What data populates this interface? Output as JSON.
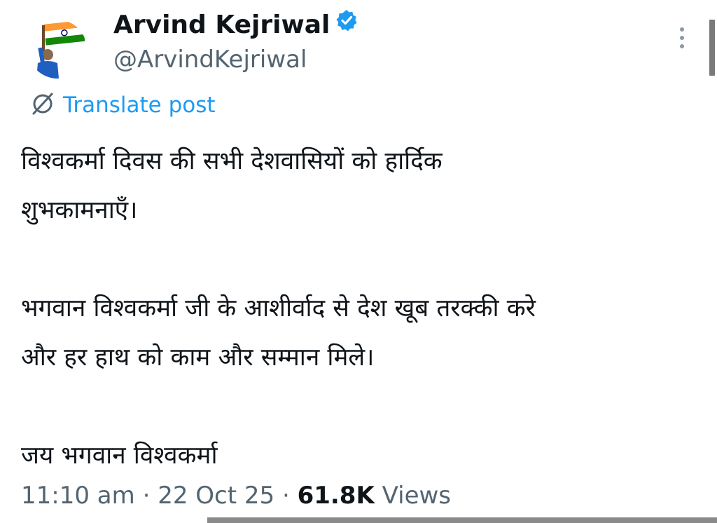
{
  "author": {
    "name": "Arvind Kejriwal",
    "handle": "@ArvindKejriwal",
    "verified_color": "#1d9bf0"
  },
  "translate": {
    "label": "Translate post",
    "icon": "translate-globe-icon"
  },
  "tweet": {
    "lines": [
      "विश्वकर्मा दिवस की सभी देशवासियों को हार्दिक",
      "शुभकामनाएँ।",
      "",
      "भगवान विश्वकर्मा जी के आशीर्वाद से देश खूब तरक्की करे",
      "और हर हाथ को काम और सम्मान मिले।",
      "",
      "जय भगवान विश्वकर्मा"
    ]
  },
  "meta": {
    "time": "11:10 am",
    "separator": "·",
    "date": "22 Oct 25",
    "views_count": "61.8K",
    "views_label": "Views"
  },
  "colors": {
    "accent": "#1d9bf0",
    "text": "#0f1419",
    "secondary": "#536471"
  }
}
